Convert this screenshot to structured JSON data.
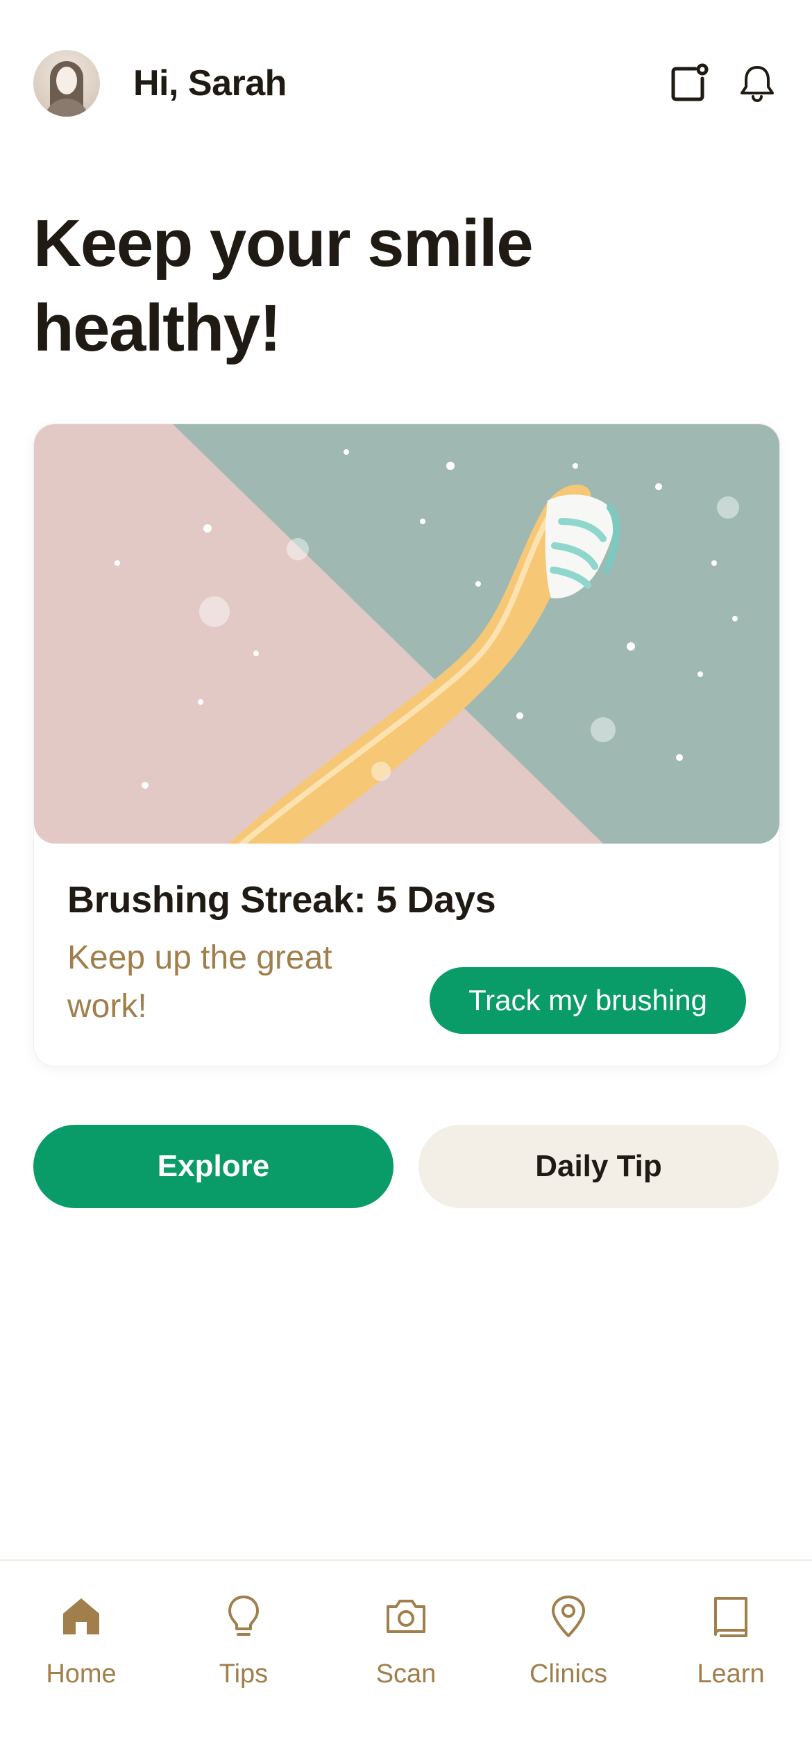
{
  "header": {
    "greeting": "Hi, Sarah",
    "avatar_icon": "user-avatar",
    "actions": [
      {
        "icon": "notes-icon"
      },
      {
        "icon": "bell-icon"
      }
    ]
  },
  "headline": {
    "line1": "Keep your smile",
    "line2": "healthy!"
  },
  "streak_card": {
    "image_icon": "toothbrush-illustration",
    "title": "Brushing Streak: 5 Days",
    "subtitle": "Keep up the great work!",
    "button_label": "Track my brushing"
  },
  "actions": {
    "explore_label": "Explore",
    "daily_tip_label": "Daily Tip"
  },
  "bottom_nav": {
    "items": [
      {
        "label": "Home",
        "icon": "home-icon",
        "active": true
      },
      {
        "label": "Tips",
        "icon": "lightbulb-icon",
        "active": false
      },
      {
        "label": "Scan",
        "icon": "camera-icon",
        "active": false
      },
      {
        "label": "Clinics",
        "icon": "map-pin-icon",
        "active": false
      },
      {
        "label": "Learn",
        "icon": "book-icon",
        "active": false
      }
    ]
  },
  "colors": {
    "accent_green": "#099b68",
    "brown_text": "#a17f4c",
    "cream": "#f4efe6",
    "dark_text": "#1f1a14"
  }
}
